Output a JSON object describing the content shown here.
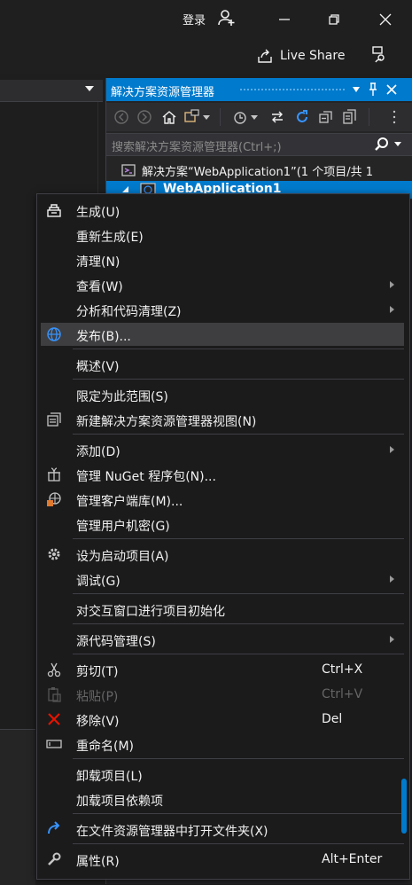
{
  "window": {
    "login_label": "登录",
    "live_share_label": "Live Share",
    "accent_color": "#007acc"
  },
  "solution_explorer": {
    "title": "解决方案资源管理器",
    "search_placeholder": "搜索解决方案资源管理器(Ctrl+;)",
    "solution_label": "解决方案“WebApplication1”(1 个项目/共 1",
    "project_label": "WebApplication1"
  },
  "context_menu": {
    "items": [
      {
        "label": "生成(U)",
        "icon": "build-icon"
      },
      {
        "label": "重新生成(E)"
      },
      {
        "label": "清理(N)"
      },
      {
        "label": "查看(W)",
        "submenu": true
      },
      {
        "label": "分析和代码清理(Z)",
        "submenu": true
      },
      {
        "label": "发布(B)...",
        "icon": "publish-globe-icon",
        "highlighted": true
      },
      {
        "label": "概述(V)"
      },
      {
        "label": "限定为此范围(S)"
      },
      {
        "label": "新建解决方案资源管理器视图(N)",
        "icon": "new-view-icon"
      },
      {
        "label": "添加(D)",
        "submenu": true
      },
      {
        "label": "管理 NuGet 程序包(N)...",
        "icon": "nuget-icon"
      },
      {
        "label": "管理客户端库(M)...",
        "icon": "client-library-icon"
      },
      {
        "label": "管理用户机密(G)"
      },
      {
        "label": "设为启动项目(A)",
        "icon": "gear-icon"
      },
      {
        "label": "调试(G)",
        "submenu": true
      },
      {
        "label": "对交互窗口进行项目初始化"
      },
      {
        "label": "源代码管理(S)",
        "submenu": true
      },
      {
        "label": "剪切(T)",
        "icon": "scissors-icon",
        "shortcut": "Ctrl+X"
      },
      {
        "label": "粘贴(P)",
        "icon": "paste-icon",
        "shortcut": "Ctrl+V",
        "disabled": true
      },
      {
        "label": "移除(V)",
        "icon": "remove-x-icon",
        "shortcut": "Del"
      },
      {
        "label": "重命名(M)",
        "icon": "rename-icon"
      },
      {
        "label": "卸载项目(L)"
      },
      {
        "label": "加载项目依赖项"
      },
      {
        "label": "在文件资源管理器中打开文件夹(X)",
        "icon": "open-folder-arrow-icon"
      },
      {
        "label": "属性(R)",
        "icon": "wrench-icon",
        "shortcut": "Alt+Enter"
      }
    ]
  }
}
